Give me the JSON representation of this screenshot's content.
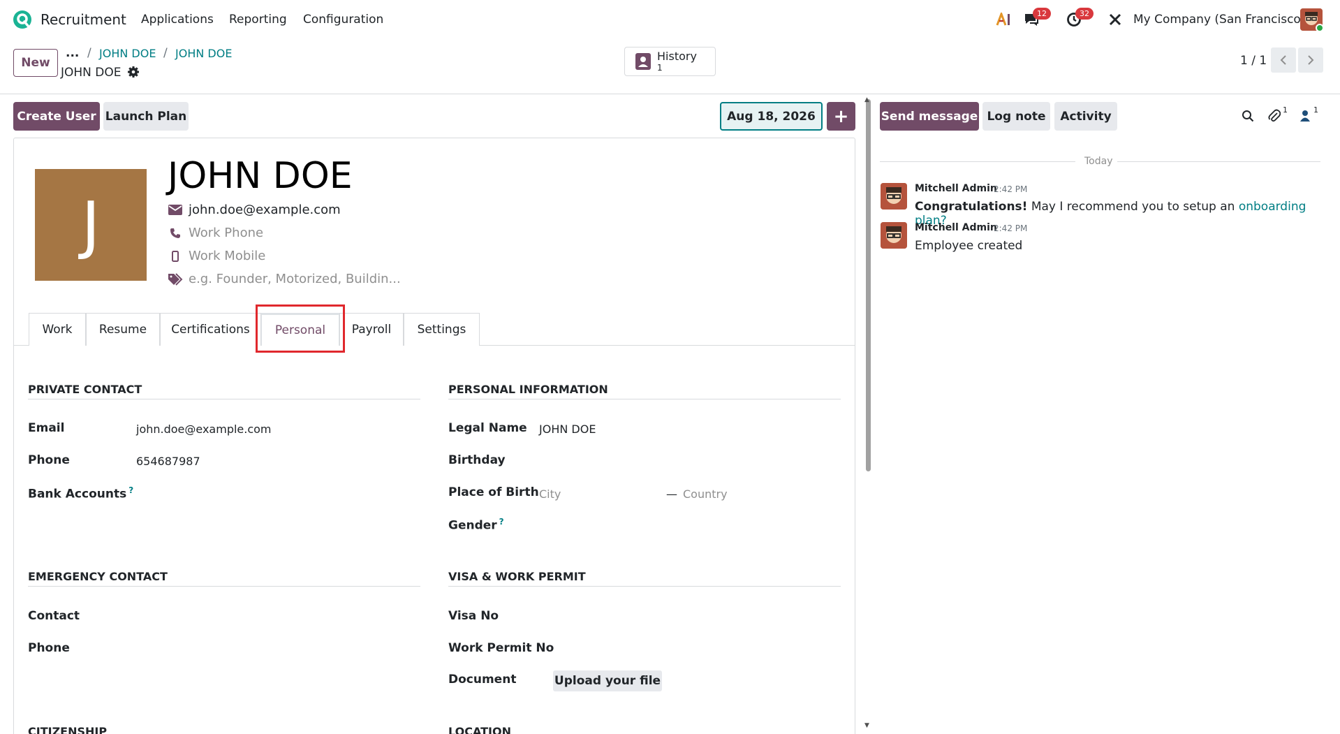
{
  "navbar": {
    "app_name": "Recruitment",
    "menu": [
      "Applications",
      "Reporting",
      "Configuration"
    ],
    "messages_badge": "12",
    "activities_badge": "32",
    "company": "My Company (San Francisco)"
  },
  "control_panel": {
    "new_label": "New",
    "breadcrumb_dots": "...",
    "breadcrumb": [
      "JOHN DOE",
      "JOHN DOE"
    ],
    "record_name": "JOHN DOE",
    "history_label": "History",
    "history_count": "1",
    "pager": "1 / 1"
  },
  "statusbar": {
    "create_user": "Create User",
    "launch_plan": "Launch Plan",
    "date": "Aug 18, 2026",
    "plus": "+"
  },
  "employee": {
    "avatar_letter": "J",
    "name": "JOHN DOE",
    "email": "john.doe@example.com",
    "work_phone_placeholder": "Work Phone",
    "work_mobile_placeholder": "Work Mobile",
    "tags_placeholder": "e.g. Founder, Motorized, Buildin..."
  },
  "tabs": [
    "Work",
    "Resume",
    "Certifications",
    "Personal",
    "Payroll",
    "Settings"
  ],
  "active_tab": "Personal",
  "private_contact": {
    "title": "PRIVATE CONTACT",
    "email_label": "Email",
    "email_value": "john.doe@example.com",
    "phone_label": "Phone",
    "phone_value": "654687987",
    "bank_label": "Bank Accounts",
    "help": "?"
  },
  "personal_info": {
    "title": "PERSONAL INFORMATION",
    "legal_name_label": "Legal Name",
    "legal_name_value": "JOHN DOE",
    "birthday_label": "Birthday",
    "place_label": "Place of Birth",
    "city_placeholder": "City",
    "dash": "—",
    "country_placeholder": "Country",
    "gender_label": "Gender",
    "help": "?"
  },
  "emergency": {
    "title": "EMERGENCY CONTACT",
    "contact_label": "Contact",
    "phone_label": "Phone"
  },
  "visa": {
    "title": "VISA & WORK PERMIT",
    "visa_label": "Visa No",
    "permit_label": "Work Permit No",
    "document_label": "Document",
    "upload_label": "Upload your file"
  },
  "citizenship": {
    "title": "CITIZENSHIP"
  },
  "location": {
    "title": "LOCATION"
  },
  "chatter": {
    "send_message": "Send message",
    "log_note": "Log note",
    "activity": "Activity",
    "attachments_count": "1",
    "followers_count": "1",
    "today": "Today",
    "messages": [
      {
        "author": "Mitchell Admin",
        "time": "2:42 PM",
        "bold": "Congratulations!",
        "text": " May I recommend you to setup an ",
        "link": "onboarding plan?"
      },
      {
        "author": "Mitchell Admin",
        "time": "2:42 PM",
        "text": "Employee created"
      }
    ]
  },
  "colors": {
    "primary": "#714b67",
    "accent": "#017e84",
    "highlight": "#e0282d"
  }
}
